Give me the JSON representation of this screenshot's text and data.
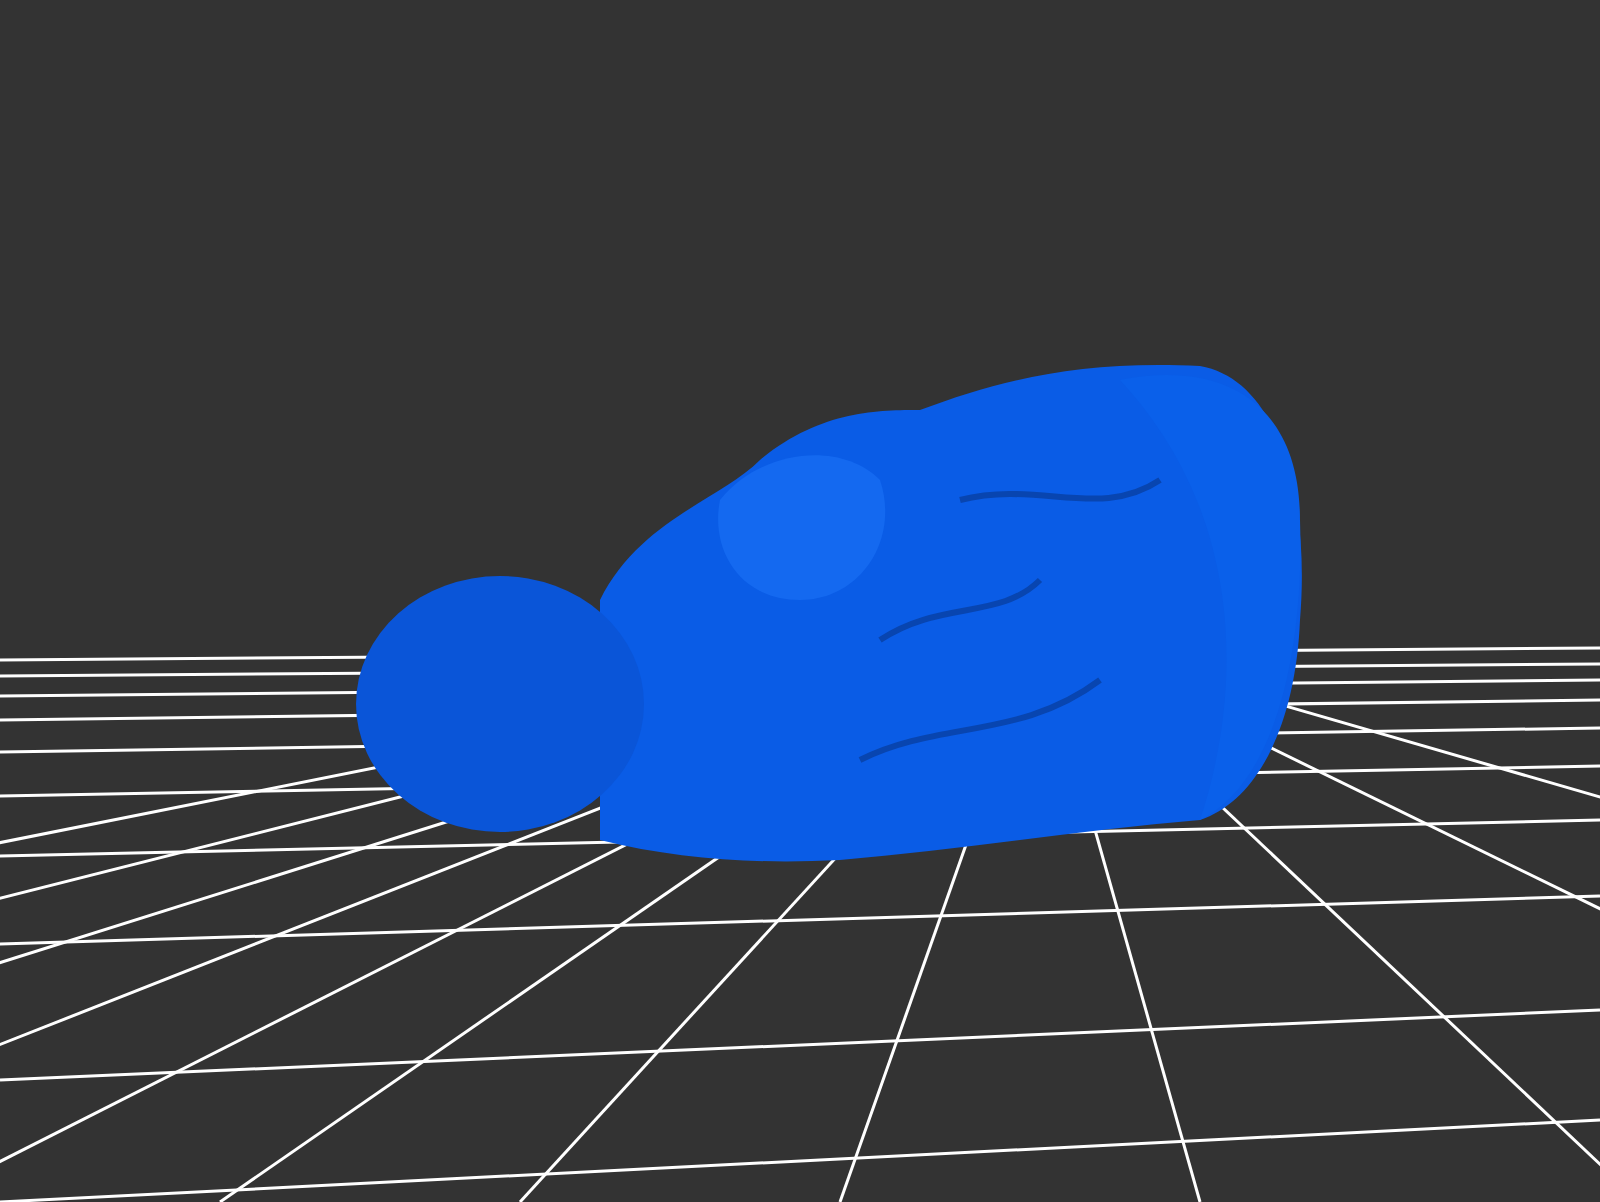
{
  "scene": [
    {
      "kind": "grid"
    },
    {
      "kind": "model"
    }
  ]
}
